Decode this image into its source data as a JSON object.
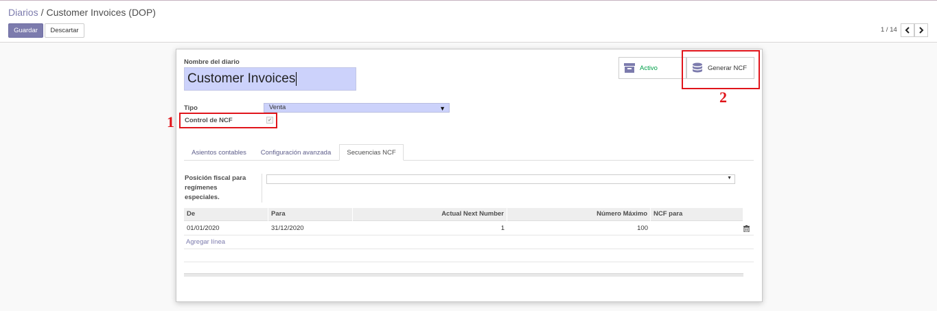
{
  "breadcrumb": {
    "parent": "Diarios",
    "separator": "/",
    "current": "Customer Invoices (DOP)"
  },
  "toolbar": {
    "save_label": "Guardar",
    "discard_label": "Descartar"
  },
  "pager": {
    "text": "1 / 14",
    "prev_icon": "chevron-left-icon",
    "next_icon": "chevron-right-icon"
  },
  "form": {
    "name_label": "Nombre del diario",
    "name_value": "Customer Invoices",
    "type_label": "Tipo",
    "type_value": "Venta",
    "ncf_control_label": "Control de NCF",
    "ncf_control_checked": true,
    "fiscal_label": "Posición fiscal para regímenes especiales.",
    "fiscal_value": ""
  },
  "stat_buttons": {
    "active_label": "Activo",
    "active_icon": "archive-icon",
    "ncf_label": "Generar NCF",
    "ncf_icon": "database-icon"
  },
  "annotations": {
    "marker1": "1",
    "marker2": "2",
    "color": "#e0141a"
  },
  "tabs": [
    {
      "label": "Asientos contables"
    },
    {
      "label": "Configuración avanzada"
    },
    {
      "label": "Secuencias NCF",
      "active": true
    }
  ],
  "table": {
    "headers": [
      "De",
      "Para",
      "Actual Next Number",
      "Número Máximo",
      "NCF para"
    ],
    "rows": [
      {
        "de": "01/01/2020",
        "para": "31/12/2020",
        "next": "1",
        "max": "100",
        "ncf": ""
      }
    ],
    "add_line": "Agregar línea",
    "delete_icon": "trash-icon"
  },
  "colors": {
    "primary": "#7c7bad",
    "active_green": "#00a04a",
    "input_focus": "#ccd2fb"
  }
}
